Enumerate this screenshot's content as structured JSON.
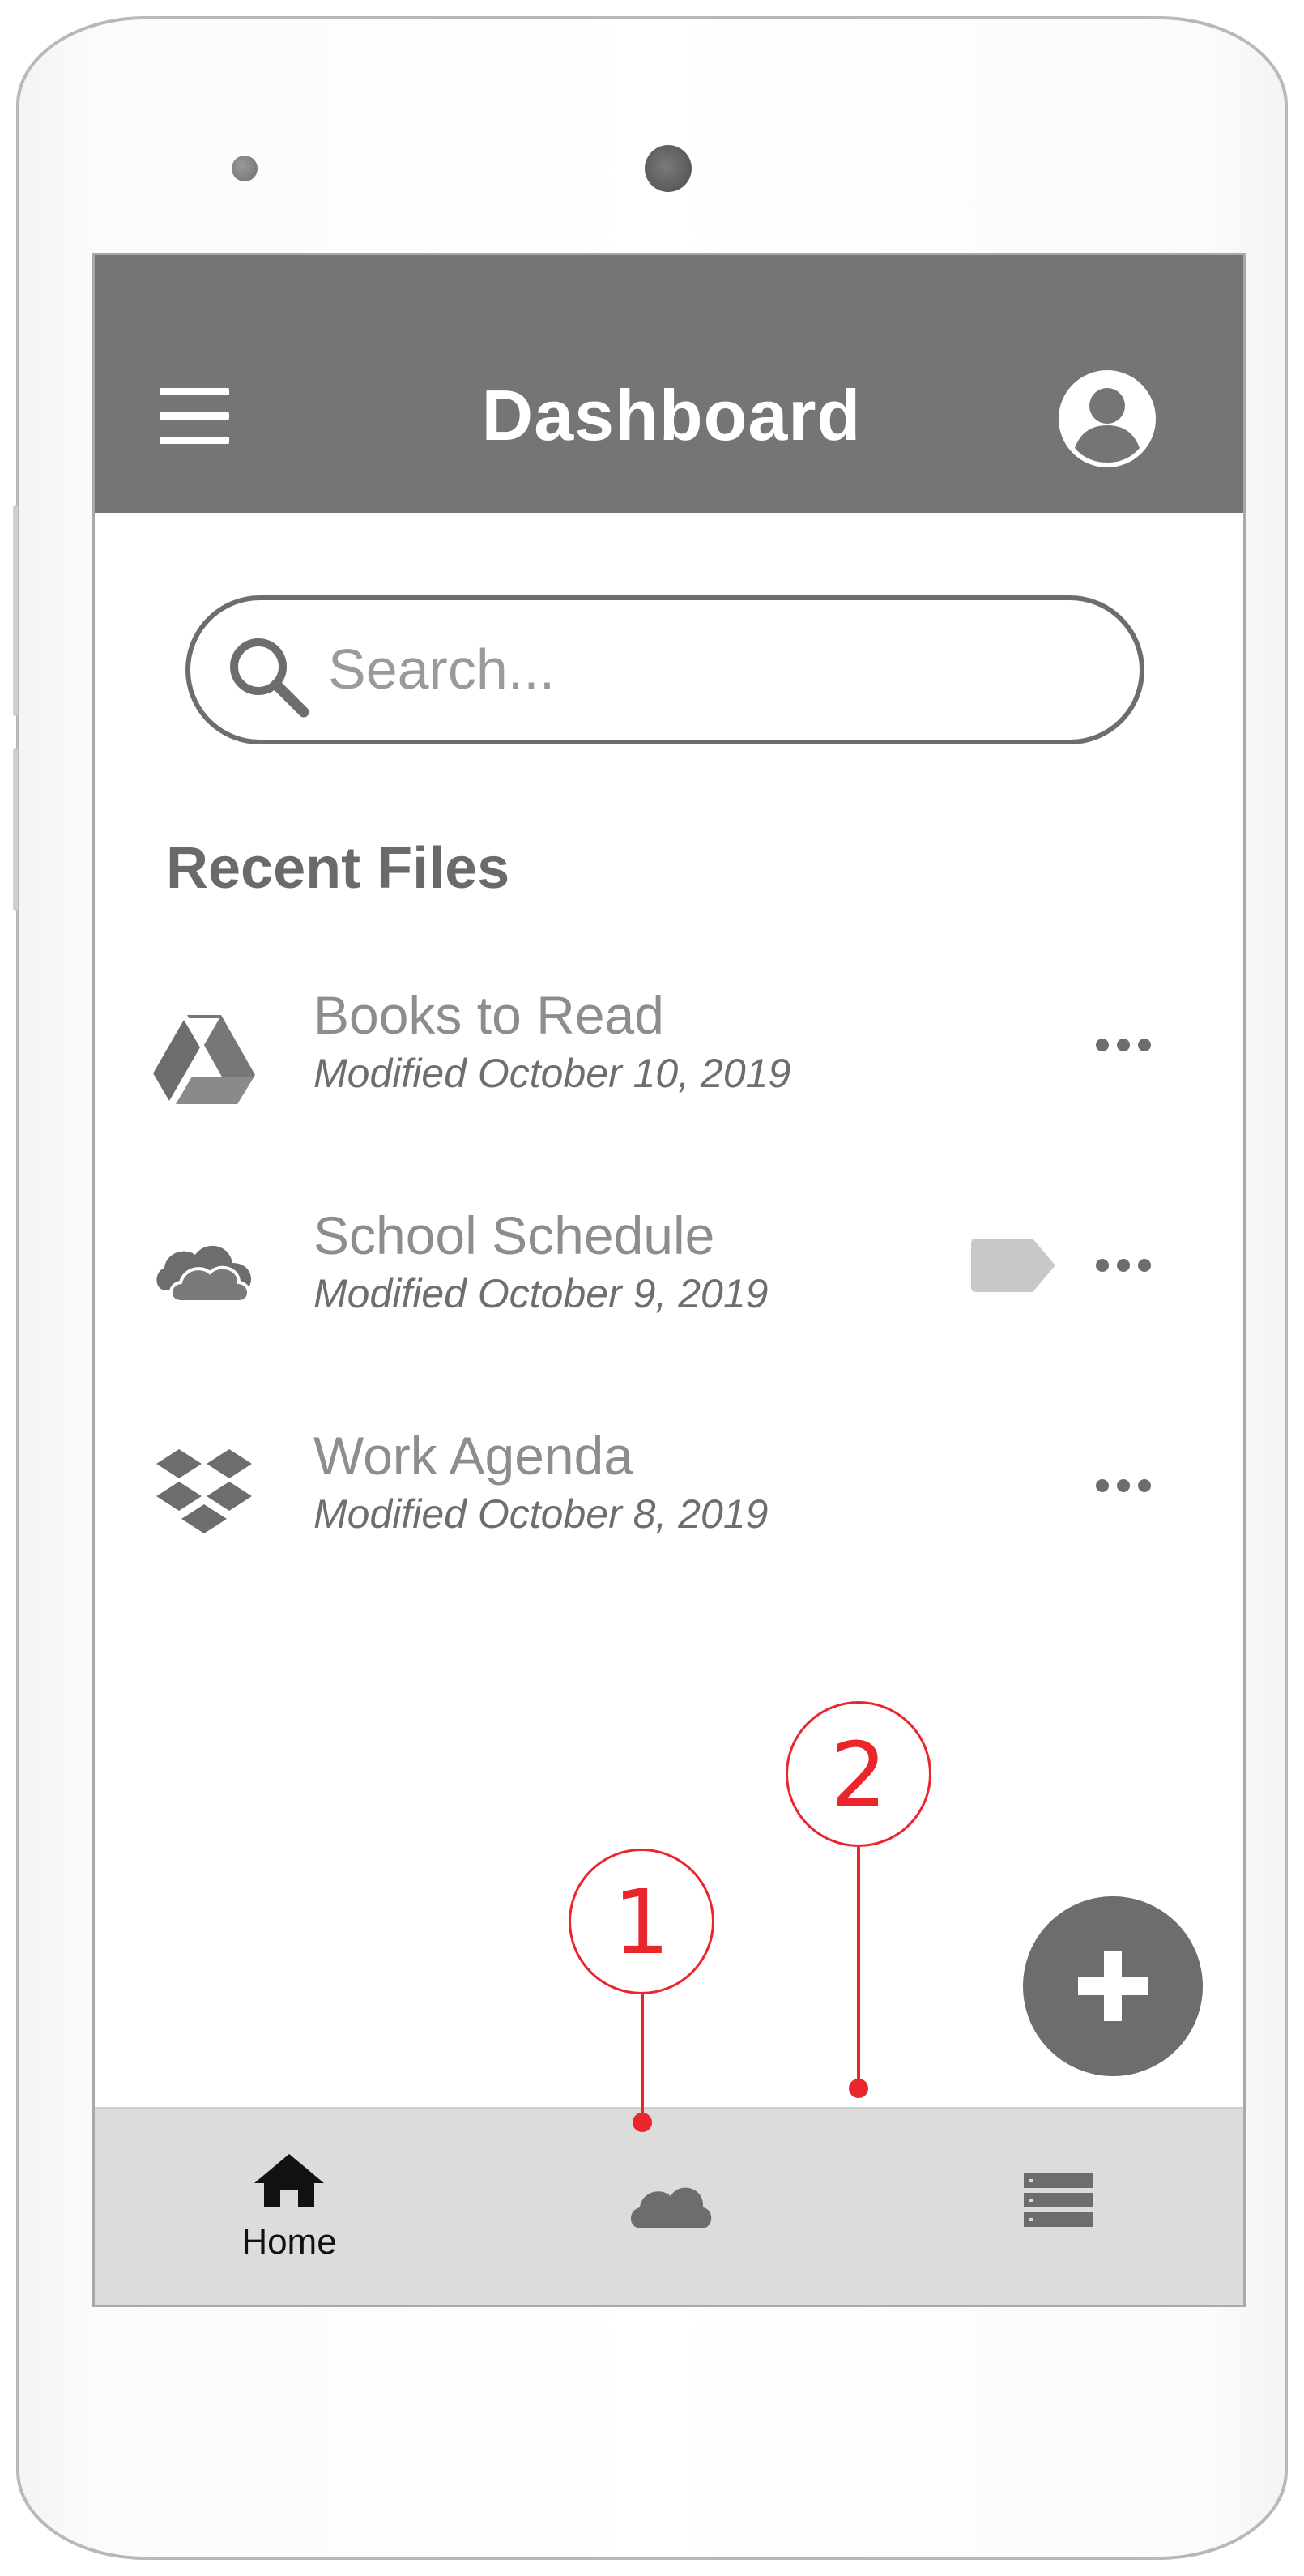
{
  "app_bar": {
    "title": "Dashboard",
    "menu_icon": "hamburger-menu-icon",
    "account_icon": "account-circle-icon"
  },
  "search": {
    "placeholder": "Search...",
    "value": "",
    "icon": "search-icon"
  },
  "recent_files": {
    "heading": "Recent Files",
    "items": [
      {
        "name": "Books to Read",
        "modified": "Modified October 10, 2019",
        "source_icon": "google-drive-icon",
        "tagged": false
      },
      {
        "name": "School Schedule",
        "modified": "Modified October 9, 2019",
        "source_icon": "onedrive-cloud-icon",
        "tagged": true
      },
      {
        "name": "Work Agenda",
        "modified": "Modified October 8, 2019",
        "source_icon": "dropbox-icon",
        "tagged": false
      }
    ]
  },
  "fab": {
    "icon": "plus-icon"
  },
  "bottom_nav": {
    "items": [
      {
        "label": "Home",
        "icon": "home-icon"
      },
      {
        "label": "",
        "icon": "cloud-icon"
      },
      {
        "label": "",
        "icon": "list-storage-icon"
      }
    ]
  },
  "annotations": [
    {
      "label": "1"
    },
    {
      "label": "2"
    }
  ],
  "colors": {
    "app_bar": "#757575",
    "bottom_nav": "#dcdcdc",
    "fab": "#6d6d6d",
    "annotation": "#e8262b",
    "tag": "#c8c8c8"
  }
}
